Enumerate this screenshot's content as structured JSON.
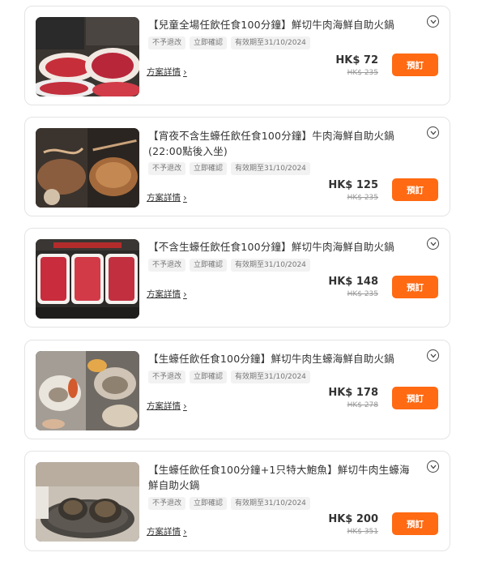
{
  "offers": [
    {
      "title": "【兒童全場任飲任食100分鐘】鮮切牛肉海鮮自助火鍋",
      "tags": [
        "不予退改",
        "立即確認",
        "有效期至31/10/2024"
      ],
      "price": "HK$ 72",
      "original_price": "HK$ 235",
      "details_label": "方案詳情",
      "book_label": "預訂",
      "image_icon": "beef-platter-image"
    },
    {
      "title": "【宵夜不含生蠔任飲任食100分鐘】牛肉海鮮自助火鍋(22:00點後入坐)",
      "tags": [
        "不予退改",
        "立即確認",
        "有效期至31/10/2024"
      ],
      "price": "HK$ 125",
      "original_price": "HK$ 235",
      "details_label": "方案詳情",
      "book_label": "預訂",
      "image_icon": "hotpot-beef-image"
    },
    {
      "title": "【不含生蠔任飲任食100分鐘】鮮切牛肉海鮮自助火鍋",
      "tags": [
        "不予退改",
        "立即確認",
        "有效期至31/10/2024"
      ],
      "price": "HK$ 148",
      "original_price": "HK$ 235",
      "details_label": "方案詳情",
      "book_label": "預訂",
      "image_icon": "sliced-beef-trays-image"
    },
    {
      "title": "【生蠔任飲任食100分鐘】鮮切牛肉生蠔海鮮自助火鍋",
      "tags": [
        "不予退改",
        "立即確認",
        "有效期至31/10/2024"
      ],
      "price": "HK$ 178",
      "original_price": "HK$ 278",
      "details_label": "方案詳情",
      "book_label": "預訂",
      "image_icon": "oysters-image"
    },
    {
      "title": "【生蠔任飲任食100分鐘+1只特大鮑魚】鮮切牛肉生蠔海鮮自助火鍋",
      "tags": [
        "不予退改",
        "立即確認",
        "有效期至31/10/2024"
      ],
      "price": "HK$ 200",
      "original_price": "HK$ 351",
      "details_label": "方案詳情",
      "book_label": "預訂",
      "image_icon": "abalone-image"
    }
  ],
  "colors": {
    "accent": "#ff6a13",
    "border": "#e4e4e4",
    "tag_bg": "#f2f2f2"
  }
}
